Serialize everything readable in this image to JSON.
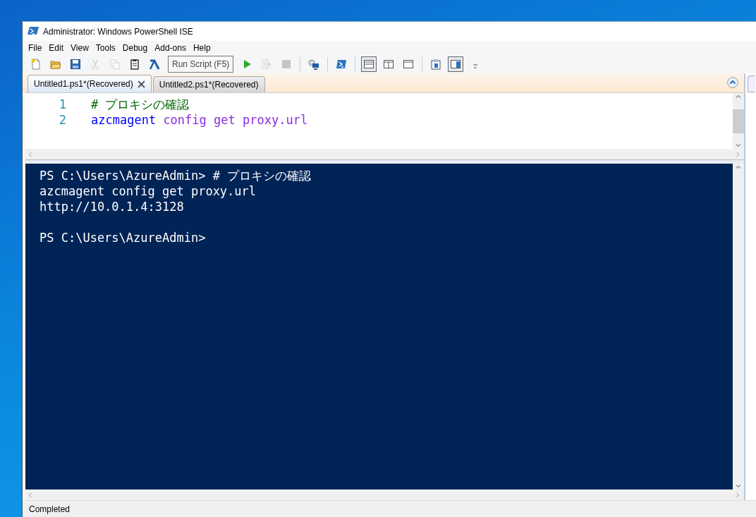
{
  "window": {
    "title": "Administrator: Windows PowerShell ISE"
  },
  "menu": [
    "File",
    "Edit",
    "View",
    "Tools",
    "Debug",
    "Add-ons",
    "Help"
  ],
  "toolbar": [
    {
      "kind": "new",
      "disabled": false,
      "selected": false
    },
    {
      "kind": "open",
      "disabled": false,
      "selected": false
    },
    {
      "kind": "save",
      "disabled": false,
      "selected": false
    },
    {
      "kind": "cut",
      "disabled": true,
      "selected": false
    },
    {
      "kind": "copy",
      "disabled": true,
      "selected": false
    },
    {
      "kind": "paste",
      "disabled": false,
      "selected": false
    },
    {
      "kind": "clear",
      "disabled": false,
      "selected": false
    },
    {
      "kind": "tooltip",
      "text": "Run Script (F5)"
    },
    {
      "kind": "run",
      "disabled": false,
      "selected": false
    },
    {
      "kind": "run-selection",
      "disabled": true,
      "selected": false
    },
    {
      "kind": "stop",
      "disabled": true,
      "selected": false
    },
    {
      "kind": "separator"
    },
    {
      "kind": "remote",
      "disabled": false,
      "selected": false
    },
    {
      "kind": "separator"
    },
    {
      "kind": "powershell",
      "disabled": false,
      "selected": false
    },
    {
      "kind": "separator"
    },
    {
      "kind": "layout-top",
      "disabled": false,
      "selected": true
    },
    {
      "kind": "layout-right",
      "disabled": false,
      "selected": false
    },
    {
      "kind": "layout-max",
      "disabled": false,
      "selected": false
    },
    {
      "kind": "separator"
    },
    {
      "kind": "script-pane",
      "disabled": false,
      "selected": false
    },
    {
      "kind": "command-pane",
      "disabled": false,
      "selected": true
    },
    {
      "kind": "overflow",
      "disabled": false,
      "selected": false
    }
  ],
  "tabs": [
    {
      "label": "Untitled1.ps1*(Recovered)",
      "selected": true
    },
    {
      "label": "Untitled2.ps1*(Recovered)",
      "selected": false
    }
  ],
  "editor": {
    "lines": [
      {
        "number": "1",
        "tokens": [
          {
            "kind": "comment",
            "text": "# プロキシの確認"
          }
        ]
      },
      {
        "number": "2",
        "tokens": [
          {
            "kind": "command",
            "text": "azcmagent"
          },
          {
            "kind": "argument",
            "text": "config"
          },
          {
            "kind": "argument",
            "text": "get"
          },
          {
            "kind": "argument",
            "text": "proxy.url"
          }
        ]
      }
    ]
  },
  "console": {
    "blocks": [
      [
        "PS C:\\Users\\AzureAdmin> # プロキシの確認",
        "azcmagent config get proxy.url",
        "http://10.0.1.4:3128"
      ],
      [
        "PS C:\\Users\\AzureAdmin>"
      ]
    ]
  },
  "status_bar": "Completed"
}
